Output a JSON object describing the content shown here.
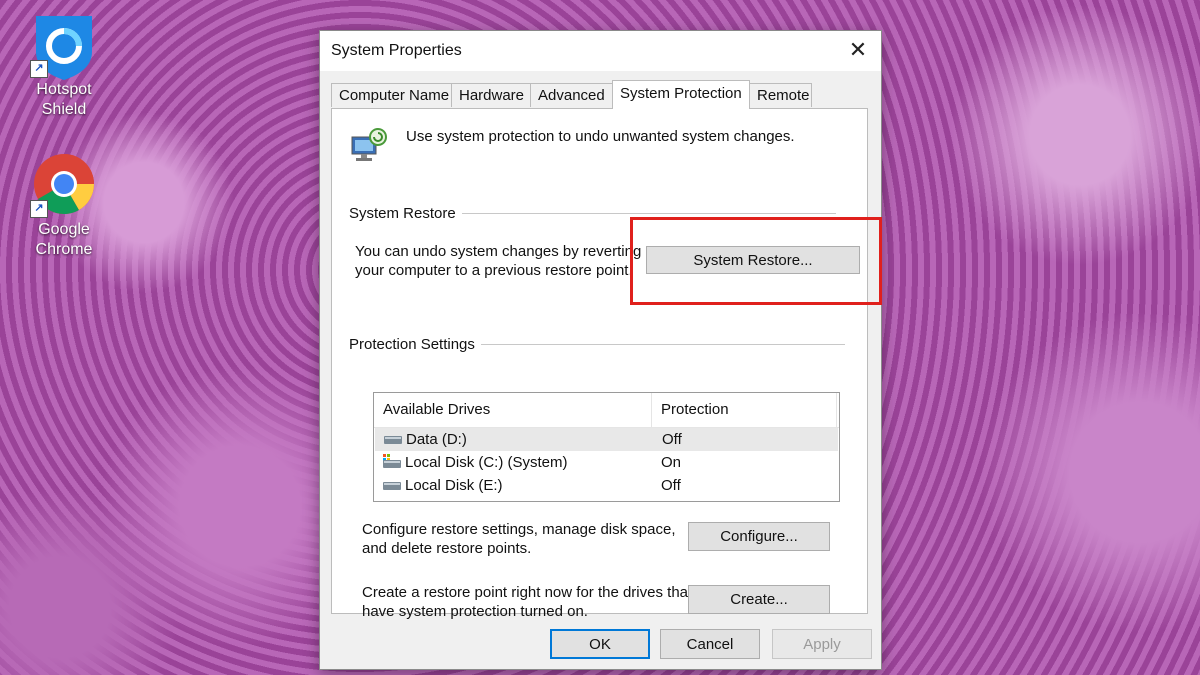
{
  "desktop": {
    "icons": [
      {
        "label_line1": "Hotspot",
        "label_line2": "Shield",
        "icon": "hotspot-shield-icon"
      },
      {
        "label_line1": "Google",
        "label_line2": "Chrome",
        "icon": "chrome-icon"
      }
    ],
    "shortcut_glyph": "↗"
  },
  "dialog": {
    "title": "System Properties",
    "close_glyph": "✕",
    "tabs": [
      {
        "label": "Computer Name"
      },
      {
        "label": "Hardware"
      },
      {
        "label": "Advanced"
      },
      {
        "label": "System Protection",
        "active": true
      },
      {
        "label": "Remote"
      }
    ],
    "intro_text": "Use system protection to undo unwanted system changes.",
    "system_restore": {
      "group_label": "System Restore",
      "text_line1": "You can undo system changes by reverting",
      "text_line2": "your computer to a previous restore point.",
      "button_label": "System Restore..."
    },
    "protection_settings": {
      "group_label": "Protection Settings",
      "columns": [
        "Available Drives",
        "Protection"
      ],
      "drives": [
        {
          "name": "Data (D:)",
          "protection": "Off",
          "system": false,
          "selected": true
        },
        {
          "name": "Local Disk (C:) (System)",
          "protection": "On",
          "system": true,
          "selected": false
        },
        {
          "name": "Local Disk (E:)",
          "protection": "Off",
          "system": false,
          "selected": false
        }
      ],
      "configure_text_line1": "Configure restore settings, manage disk space,",
      "configure_text_line2": "and delete restore points.",
      "configure_button": "Configure...",
      "create_text_line1": "Create a restore point right now for the drives that",
      "create_text_line2": "have system protection turned on.",
      "create_button": "Create..."
    },
    "footer": {
      "ok": "OK",
      "cancel": "Cancel",
      "apply": "Apply"
    }
  },
  "colors": {
    "highlight": "#e0201c",
    "accent": "#0078d7",
    "desktop": "#a04ea0"
  }
}
